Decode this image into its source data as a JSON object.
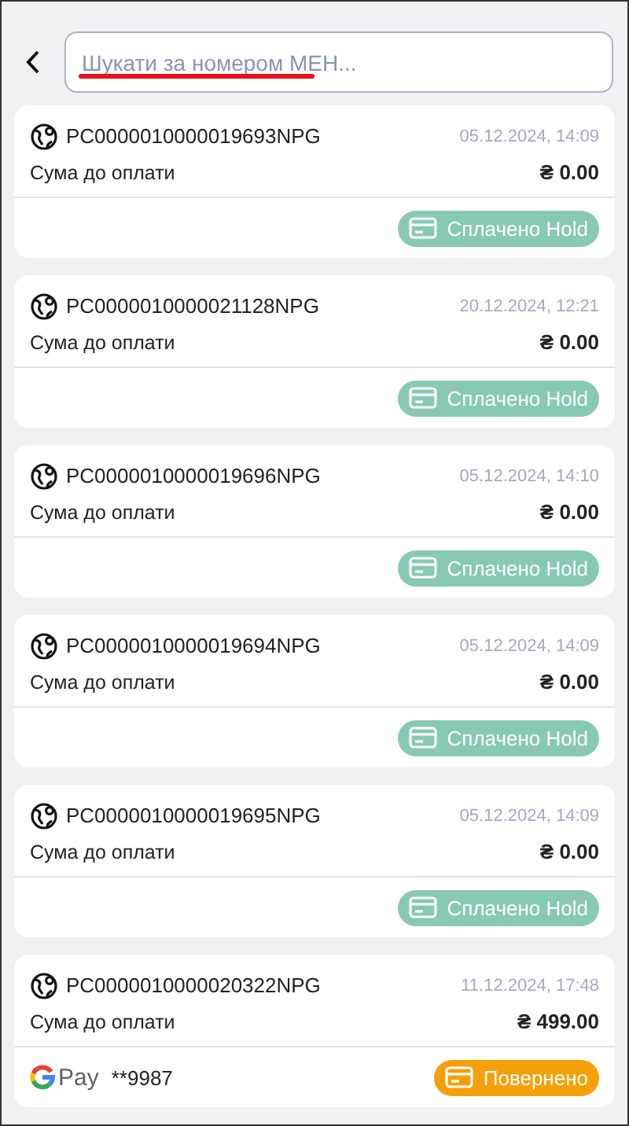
{
  "search": {
    "placeholder": "Шукати за номером МЕН...",
    "spellcheck_underline": true
  },
  "orders": [
    {
      "number": "PC0000010000019693NPG",
      "date": "05.12.2024, 14:09",
      "amount_label": "Сума до оплати",
      "amount": "₴ 0.00",
      "status": {
        "label": "Сплачено Hold",
        "color": "#88c9b4"
      }
    },
    {
      "number": "PC0000010000021128NPG",
      "date": "20.12.2024, 12:21",
      "amount_label": "Сума до оплати",
      "amount": "₴ 0.00",
      "status": {
        "label": "Сплачено Hold",
        "color": "#88c9b4"
      }
    },
    {
      "number": "PC0000010000019696NPG",
      "date": "05.12.2024, 14:10",
      "amount_label": "Сума до оплати",
      "amount": "₴ 0.00",
      "status": {
        "label": "Сплачено Hold",
        "color": "#88c9b4"
      }
    },
    {
      "number": "PC0000010000019694NPG",
      "date": "05.12.2024, 14:09",
      "amount_label": "Сума до оплати",
      "amount": "₴ 0.00",
      "status": {
        "label": "Сплачено Hold",
        "color": "#88c9b4"
      }
    },
    {
      "number": "PC0000010000019695NPG",
      "date": "05.12.2024, 14:09",
      "amount_label": "Сума до оплати",
      "amount": "₴ 0.00",
      "status": {
        "label": "Сплачено Hold",
        "color": "#88c9b4"
      }
    },
    {
      "number": "PC0000010000020322NPG",
      "date": "11.12.2024, 17:48",
      "amount_label": "Сума до оплати",
      "amount": "₴ 499.00",
      "payment": {
        "kind": "gpay",
        "label": "Pay",
        "card": "**9987"
      },
      "status": {
        "label": "Повернено",
        "color": "#f5a00a"
      }
    }
  ]
}
